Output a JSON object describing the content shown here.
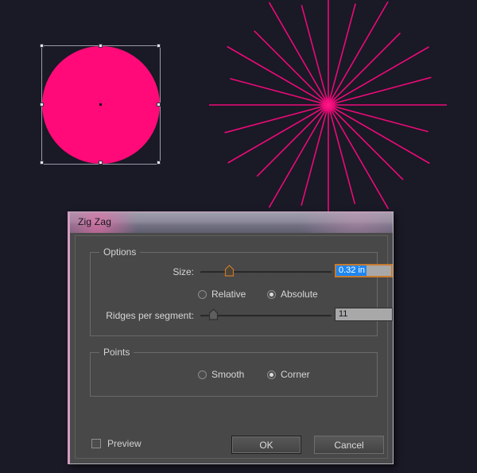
{
  "canvas": {
    "background_color": "#1a1926",
    "artwork": [
      {
        "name": "circle",
        "fill_color": "#ff0a78",
        "selected": true,
        "selection_handle_color": "#e8e8ef"
      },
      {
        "name": "zigzag-starburst",
        "stroke_color": "#ec0a78",
        "spike_count": 24
      }
    ]
  },
  "dialog": {
    "title": "Zig Zag",
    "options": {
      "legend": "Options",
      "size": {
        "label": "Size:",
        "value": "0.32 in",
        "slider_percent": 21,
        "focused": true,
        "selected": true
      },
      "mode": {
        "options": [
          "Relative",
          "Absolute"
        ],
        "selected": "Absolute"
      },
      "ridges": {
        "label": "Ridges per segment:",
        "value": "11",
        "slider_percent": 11
      }
    },
    "points": {
      "legend": "Points",
      "options": [
        "Smooth",
        "Corner"
      ],
      "selected": "Corner"
    },
    "preview": {
      "label": "Preview",
      "checked": false
    },
    "buttons": {
      "ok": "OK",
      "cancel": "Cancel"
    }
  }
}
